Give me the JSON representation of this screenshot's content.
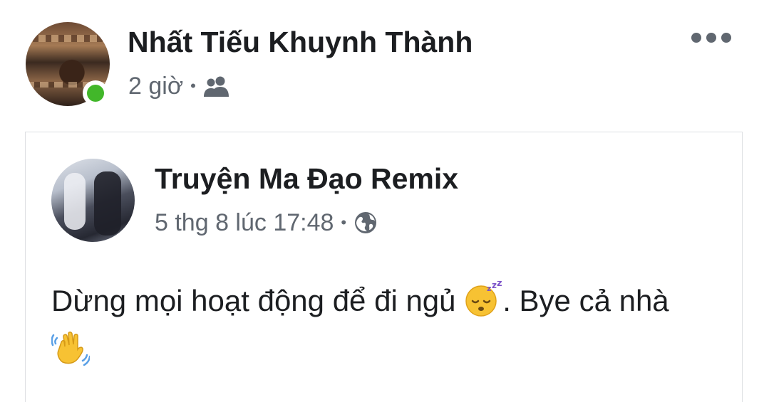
{
  "post": {
    "author_name": "Nhất Tiếu Khuynh Thành",
    "timestamp": "2 giờ",
    "audience_icon": "friends-icon",
    "separator": "•",
    "online_status_color": "#42b72a",
    "more_icon": "more-options-icon"
  },
  "shared_post": {
    "page_name": "Truyện Ma Đạo Remix",
    "timestamp": "5 thg 8 lúc 17:48",
    "separator": "•",
    "audience_icon": "globe-icon",
    "text_part1": "Dừng mọi hoạt động để đi ngủ ",
    "emoji_1": "sleeping-face-icon",
    "text_part2": ". Bye cả nhà ",
    "emoji_2": "waving-hand-icon"
  },
  "colors": {
    "primary_text": "#1c1e21",
    "secondary_text": "#606770",
    "border": "#dddfe2"
  }
}
